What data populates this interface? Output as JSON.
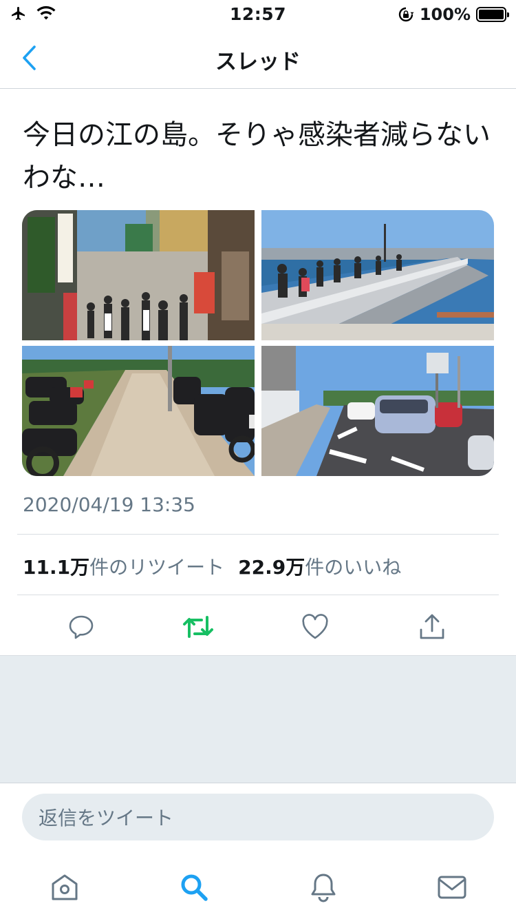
{
  "status_bar": {
    "time": "12:57",
    "battery": "100%",
    "icons": [
      "airplane-icon",
      "wifi-icon",
      "orientation-lock-icon",
      "battery-icon"
    ]
  },
  "nav": {
    "title": "スレッド",
    "back_icon": "chevron-left-icon"
  },
  "tweet": {
    "text": "今日の江の島。そりゃ感染者減らないわな…",
    "timestamp": "2020/04/19 13:35",
    "retweets_count": "11.1万",
    "retweets_label": "件のリツイート",
    "likes_count": "22.9万",
    "likes_label": "件のいいね",
    "media": [
      "shopping-street-photo",
      "bridge-walkway-photo",
      "parked-motorcycles-photo",
      "bus-lane-road-photo"
    ]
  },
  "actions": {
    "icons": [
      "reply-icon",
      "retweet-icon",
      "like-icon",
      "share-icon"
    ],
    "retweet_color": "#17bf63"
  },
  "reply": {
    "placeholder": "返信をツイート"
  },
  "tab_bar": {
    "icons": [
      "home-icon",
      "search-icon",
      "notifications-icon",
      "messages-icon"
    ],
    "active": "search-icon"
  },
  "colors": {
    "accent": "#1da1f2",
    "secondary_text": "#657786",
    "background_gray": "#e6ecf0"
  }
}
